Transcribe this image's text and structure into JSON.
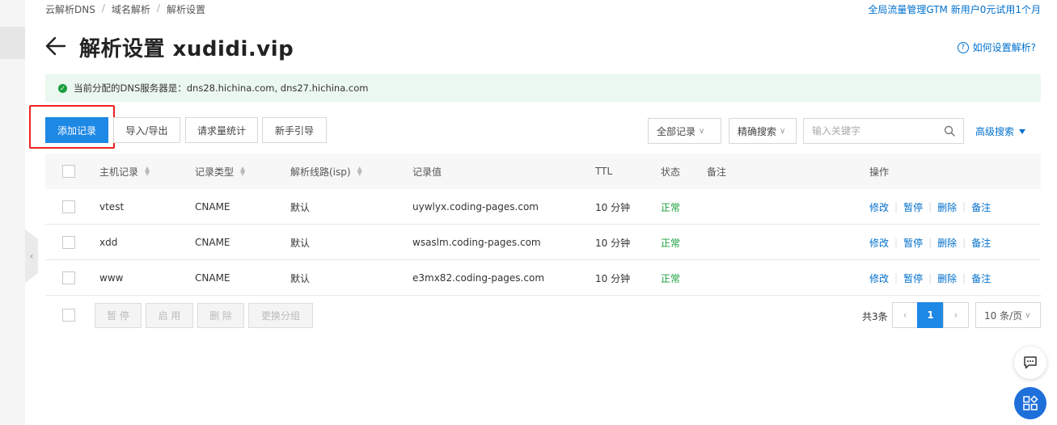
{
  "breadcrumb": [
    "云解析DNS",
    "域名解析",
    "解析设置"
  ],
  "breadcrumb_sep": "/",
  "promo_link": "全局流量管理GTM 新用户0元试用1个月",
  "title": "解析设置 xudidi.vip",
  "help_link": "如何设置解析?",
  "help_icon": "?",
  "notice": "当前分配的DNS服务器是：dns28.hichina.com, dns27.hichina.com",
  "toolbar": {
    "add": "添加记录",
    "import_export": "导入/导出",
    "stats": "请求量统计",
    "guide": "新手引导"
  },
  "filters": {
    "record_scope": "全部记录",
    "search_mode": "精确搜索",
    "search_placeholder": "输入关键字",
    "advanced": "高级搜索"
  },
  "table": {
    "headers": {
      "host": "主机记录",
      "type": "记录类型",
      "line": "解析线路(isp)",
      "value": "记录值",
      "ttl": "TTL",
      "status": "状态",
      "remark": "备注",
      "ops": "操作"
    },
    "rows": [
      {
        "host": "vtest",
        "type": "CNAME",
        "line": "默认",
        "value": "uywlyx.coding-pages.com",
        "ttl": "10 分钟",
        "status": "正常",
        "remark": ""
      },
      {
        "host": "xdd",
        "type": "CNAME",
        "line": "默认",
        "value": "wsaslm.coding-pages.com",
        "ttl": "10 分钟",
        "status": "正常",
        "remark": ""
      },
      {
        "host": "www",
        "type": "CNAME",
        "line": "默认",
        "value": "e3mx82.coding-pages.com",
        "ttl": "10 分钟",
        "status": "正常",
        "remark": ""
      }
    ],
    "ops": {
      "edit": "修改",
      "pause": "暂停",
      "delete": "删除",
      "remark": "备注"
    }
  },
  "bulk": {
    "pause": "暂 停",
    "enable": "启 用",
    "delete": "删 除",
    "group": "更换分组"
  },
  "pagination": {
    "total": "共3条",
    "current": "1",
    "prev": "‹",
    "next": "›",
    "page_size": "10 条/页"
  },
  "colors": {
    "primary": "#1e88e5",
    "link": "#0070cc",
    "success": "#1a9f3c",
    "notice_bg": "#ebf8ef",
    "highlight": "#e22222"
  }
}
